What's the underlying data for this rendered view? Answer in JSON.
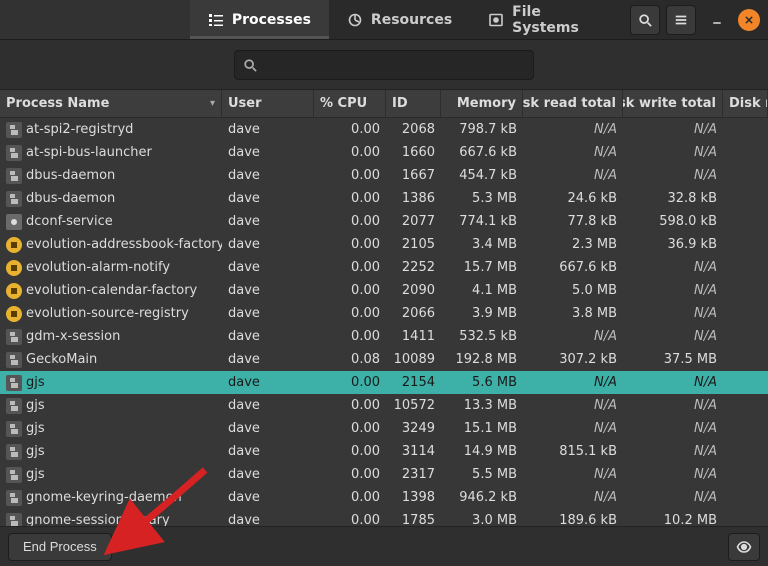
{
  "tabs": {
    "processes": "Processes",
    "resources": "Resources",
    "filesystems": "File Systems"
  },
  "search": {
    "placeholder": ""
  },
  "columns": {
    "name": "Process Name",
    "user": "User",
    "cpu": "% CPU",
    "id": "ID",
    "mem": "Memory",
    "drt": "Disk read total",
    "dwt": "Disk write total",
    "drr": "Disk r"
  },
  "sort_indicator": "▾",
  "footer": {
    "end_process": "End Process"
  },
  "selected_index": 11,
  "rows": [
    {
      "icon": "generic",
      "name": "at-spi2-registryd",
      "user": "dave",
      "cpu": "0.00",
      "id": "2068",
      "mem": "798.7 kB",
      "drt": "N/A",
      "dwt": "N/A"
    },
    {
      "icon": "generic",
      "name": "at-spi-bus-launcher",
      "user": "dave",
      "cpu": "0.00",
      "id": "1660",
      "mem": "667.6 kB",
      "drt": "N/A",
      "dwt": "N/A"
    },
    {
      "icon": "generic",
      "name": "dbus-daemon",
      "user": "dave",
      "cpu": "0.00",
      "id": "1667",
      "mem": "454.7 kB",
      "drt": "N/A",
      "dwt": "N/A"
    },
    {
      "icon": "generic",
      "name": "dbus-daemon",
      "user": "dave",
      "cpu": "0.00",
      "id": "1386",
      "mem": "5.3 MB",
      "drt": "24.6 kB",
      "dwt": "32.8 kB"
    },
    {
      "icon": "gray",
      "name": "dconf-service",
      "user": "dave",
      "cpu": "0.00",
      "id": "2077",
      "mem": "774.1 kB",
      "drt": "77.8 kB",
      "dwt": "598.0 kB"
    },
    {
      "icon": "yellow",
      "name": "evolution-addressbook-factory",
      "user": "dave",
      "cpu": "0.00",
      "id": "2105",
      "mem": "3.4 MB",
      "drt": "2.3 MB",
      "dwt": "36.9 kB"
    },
    {
      "icon": "yellow",
      "name": "evolution-alarm-notify",
      "user": "dave",
      "cpu": "0.00",
      "id": "2252",
      "mem": "15.7 MB",
      "drt": "667.6 kB",
      "dwt": "N/A"
    },
    {
      "icon": "yellow",
      "name": "evolution-calendar-factory",
      "user": "dave",
      "cpu": "0.00",
      "id": "2090",
      "mem": "4.1 MB",
      "drt": "5.0 MB",
      "dwt": "N/A"
    },
    {
      "icon": "yellow",
      "name": "evolution-source-registry",
      "user": "dave",
      "cpu": "0.00",
      "id": "2066",
      "mem": "3.9 MB",
      "drt": "3.8 MB",
      "dwt": "N/A"
    },
    {
      "icon": "generic",
      "name": "gdm-x-session",
      "user": "dave",
      "cpu": "0.00",
      "id": "1411",
      "mem": "532.5 kB",
      "drt": "N/A",
      "dwt": "N/A"
    },
    {
      "icon": "generic",
      "name": "GeckoMain",
      "user": "dave",
      "cpu": "0.08",
      "id": "10089",
      "mem": "192.8 MB",
      "drt": "307.2 kB",
      "dwt": "37.5 MB"
    },
    {
      "icon": "generic",
      "name": "gjs",
      "user": "dave",
      "cpu": "0.00",
      "id": "2154",
      "mem": "5.6 MB",
      "drt": "N/A",
      "dwt": "N/A"
    },
    {
      "icon": "generic",
      "name": "gjs",
      "user": "dave",
      "cpu": "0.00",
      "id": "10572",
      "mem": "13.3 MB",
      "drt": "N/A",
      "dwt": "N/A"
    },
    {
      "icon": "generic",
      "name": "gjs",
      "user": "dave",
      "cpu": "0.00",
      "id": "3249",
      "mem": "15.1 MB",
      "drt": "N/A",
      "dwt": "N/A"
    },
    {
      "icon": "generic",
      "name": "gjs",
      "user": "dave",
      "cpu": "0.00",
      "id": "3114",
      "mem": "14.9 MB",
      "drt": "815.1 kB",
      "dwt": "N/A"
    },
    {
      "icon": "generic",
      "name": "gjs",
      "user": "dave",
      "cpu": "0.00",
      "id": "2317",
      "mem": "5.5 MB",
      "drt": "N/A",
      "dwt": "N/A"
    },
    {
      "icon": "generic",
      "name": "gnome-keyring-daemon",
      "user": "dave",
      "cpu": "0.00",
      "id": "1398",
      "mem": "946.2 kB",
      "drt": "N/A",
      "dwt": "N/A"
    },
    {
      "icon": "generic",
      "name": "gnome-session-binary",
      "user": "dave",
      "cpu": "0.00",
      "id": "1785",
      "mem": "3.0 MB",
      "drt": "189.6 kB",
      "dwt": "10.2 MB"
    }
  ]
}
